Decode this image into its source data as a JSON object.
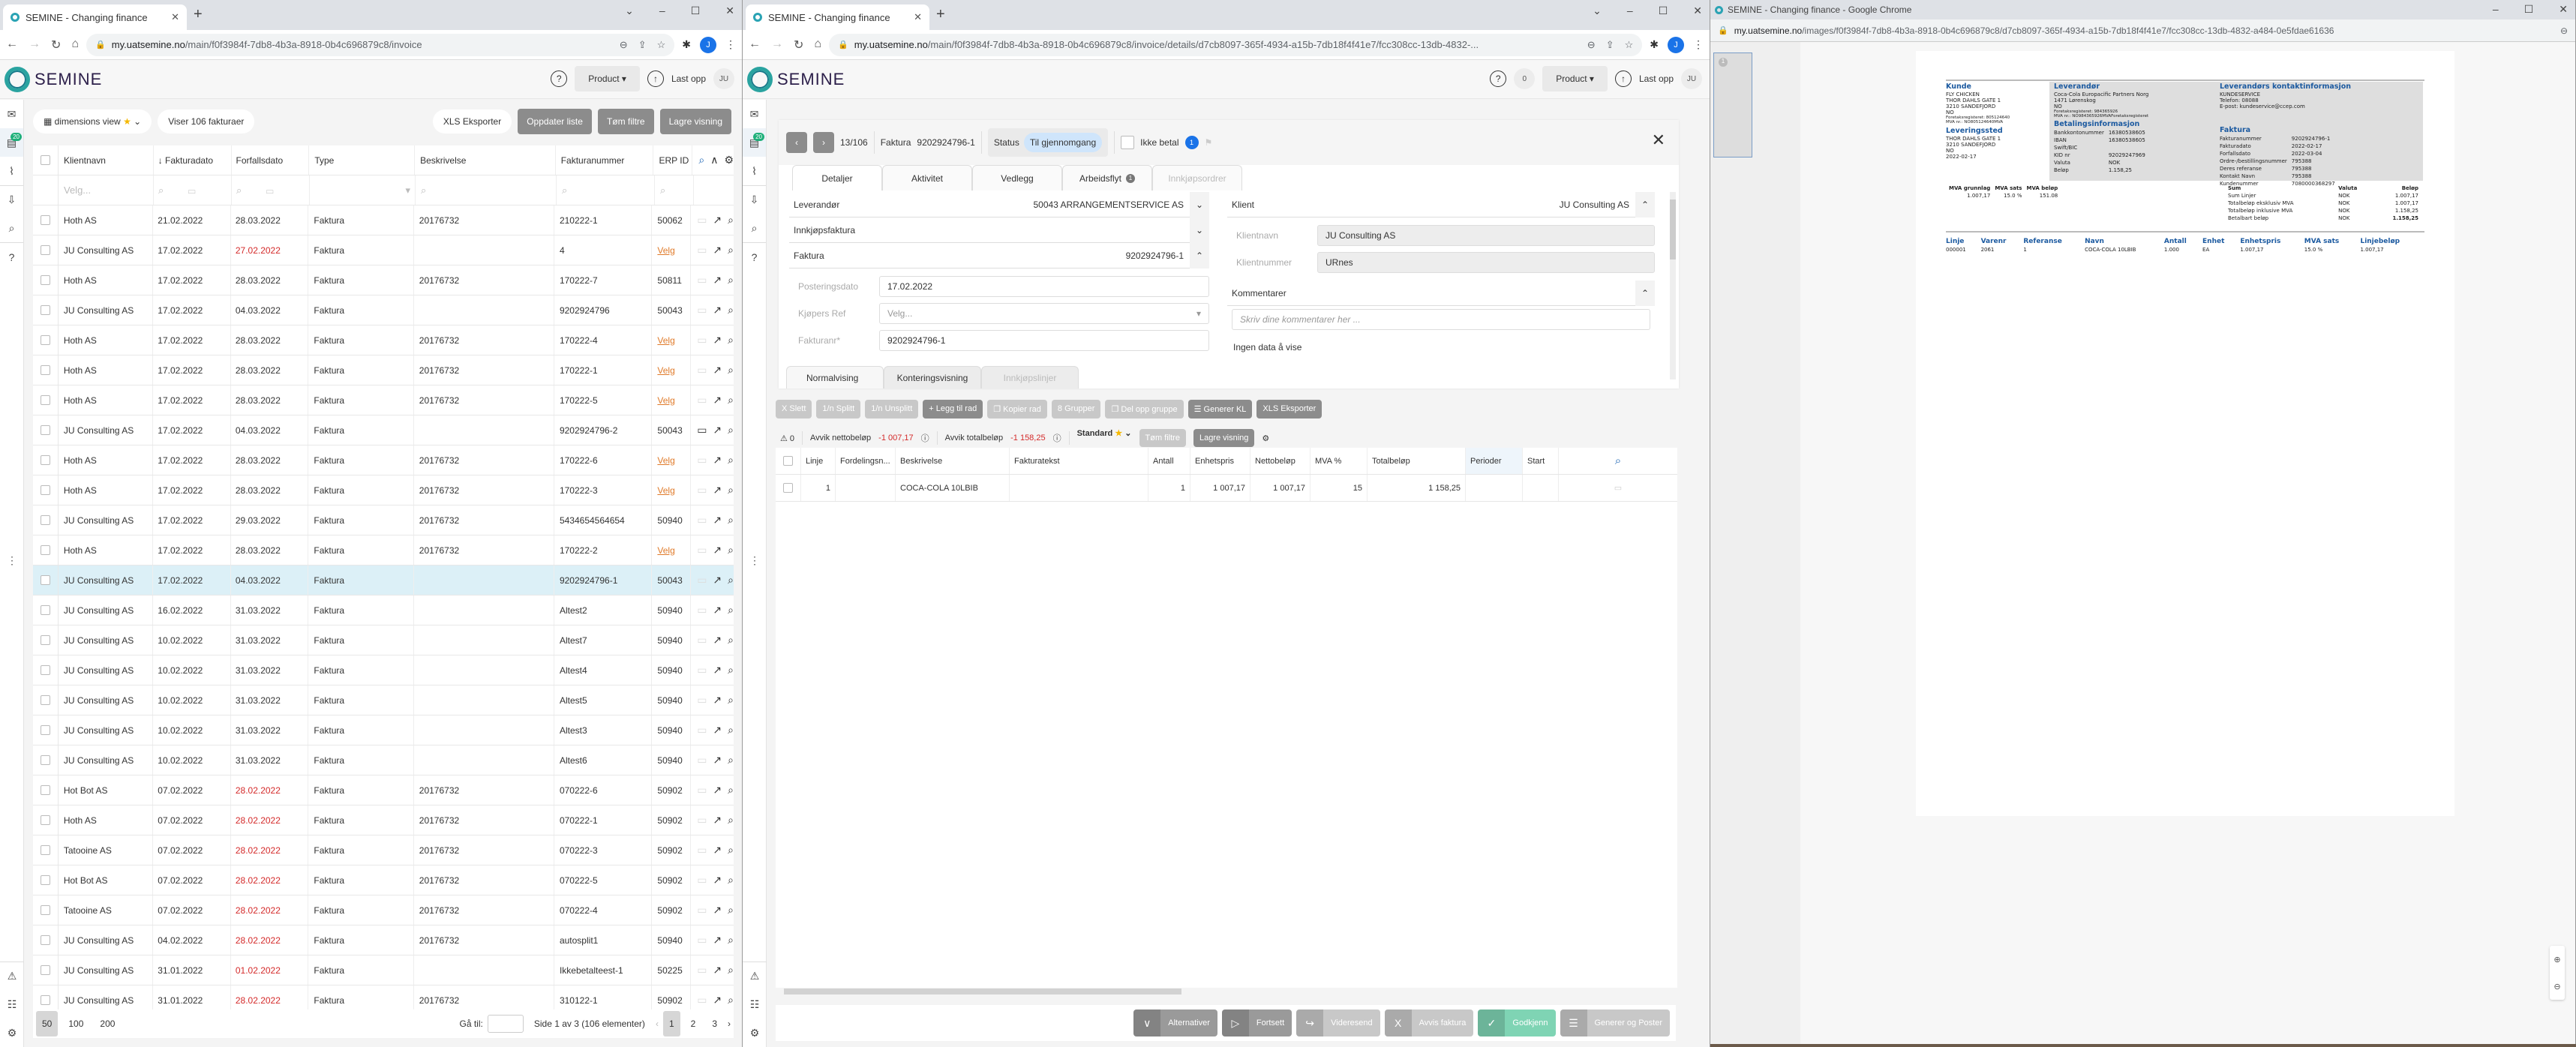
{
  "browser": {
    "tab_title": "SEMINE - Changing finance",
    "profile_initial": "J"
  },
  "window1": {
    "url_host": "my.uatsemine.no",
    "url_path": "/main/f0f3984f-7db8-4b3a-8918-0b4c696879c8/invoice",
    "app": {
      "logo": "SEMINE",
      "help": "?",
      "product_label": "Product",
      "upload_label": "Last opp",
      "user_initials": "JU"
    },
    "rail_badge": "20",
    "toolbar": {
      "view_label": "dimensions view",
      "count_label": "Viser 106 fakturaer",
      "export_label": "XLS Eksporter",
      "refresh_label": "Oppdater liste",
      "clear_filters_label": "Tøm filtre",
      "save_view_label": "Lagre visning"
    },
    "columns": [
      "Klientnavn",
      "Fakturadato",
      "Forfallsdato",
      "Type",
      "Beskrivelse",
      "Fakturanummer",
      "ERP ID"
    ],
    "filter_placeholder": "Velg...",
    "rows": [
      {
        "client": "Hoth AS",
        "inv_date": "21.02.2022",
        "due": "28.03.2022",
        "due_overdue": false,
        "type": "Faktura",
        "desc": "20176732",
        "no": "210222-1",
        "erp": "50062",
        "comment": false,
        "selected": false
      },
      {
        "client": "JU Consulting AS",
        "inv_date": "17.02.2022",
        "due": "27.02.2022",
        "due_overdue": true,
        "type": "Faktura",
        "desc": "",
        "no": "4",
        "erp": "Velg",
        "comment": false,
        "selected": false
      },
      {
        "client": "Hoth AS",
        "inv_date": "17.02.2022",
        "due": "28.03.2022",
        "due_overdue": false,
        "type": "Faktura",
        "desc": "20176732",
        "no": "170222-7",
        "erp": "50811",
        "comment": false,
        "selected": false
      },
      {
        "client": "JU Consulting AS",
        "inv_date": "17.02.2022",
        "due": "04.03.2022",
        "due_overdue": false,
        "type": "Faktura",
        "desc": "",
        "no": "9202924796",
        "erp": "50043",
        "comment": false,
        "selected": false
      },
      {
        "client": "Hoth AS",
        "inv_date": "17.02.2022",
        "due": "28.03.2022",
        "due_overdue": false,
        "type": "Faktura",
        "desc": "20176732",
        "no": "170222-4",
        "erp": "Velg",
        "comment": false,
        "selected": false
      },
      {
        "client": "Hoth AS",
        "inv_date": "17.02.2022",
        "due": "28.03.2022",
        "due_overdue": false,
        "type": "Faktura",
        "desc": "20176732",
        "no": "170222-1",
        "erp": "Velg",
        "comment": false,
        "selected": false
      },
      {
        "client": "Hoth AS",
        "inv_date": "17.02.2022",
        "due": "28.03.2022",
        "due_overdue": false,
        "type": "Faktura",
        "desc": "20176732",
        "no": "170222-5",
        "erp": "Velg",
        "comment": false,
        "selected": false
      },
      {
        "client": "JU Consulting AS",
        "inv_date": "17.02.2022",
        "due": "04.03.2022",
        "due_overdue": false,
        "type": "Faktura",
        "desc": "",
        "no": "9202924796-2",
        "erp": "50043",
        "comment": true,
        "selected": false
      },
      {
        "client": "Hoth AS",
        "inv_date": "17.02.2022",
        "due": "28.03.2022",
        "due_overdue": false,
        "type": "Faktura",
        "desc": "20176732",
        "no": "170222-6",
        "erp": "Velg",
        "comment": false,
        "selected": false
      },
      {
        "client": "Hoth AS",
        "inv_date": "17.02.2022",
        "due": "28.03.2022",
        "due_overdue": false,
        "type": "Faktura",
        "desc": "20176732",
        "no": "170222-3",
        "erp": "Velg",
        "comment": false,
        "selected": false
      },
      {
        "client": "JU Consulting AS",
        "inv_date": "17.02.2022",
        "due": "29.03.2022",
        "due_overdue": false,
        "type": "Faktura",
        "desc": "20176732",
        "no": "5434654564654",
        "erp": "50940",
        "comment": false,
        "selected": false
      },
      {
        "client": "Hoth AS",
        "inv_date": "17.02.2022",
        "due": "28.03.2022",
        "due_overdue": false,
        "type": "Faktura",
        "desc": "20176732",
        "no": "170222-2",
        "erp": "Velg",
        "comment": false,
        "selected": false
      },
      {
        "client": "JU Consulting AS",
        "inv_date": "17.02.2022",
        "due": "04.03.2022",
        "due_overdue": false,
        "type": "Faktura",
        "desc": "",
        "no": "9202924796-1",
        "erp": "50043",
        "comment": false,
        "selected": true
      },
      {
        "client": "JU Consulting AS",
        "inv_date": "16.02.2022",
        "due": "31.03.2022",
        "due_overdue": false,
        "type": "Faktura",
        "desc": "",
        "no": "Altest2",
        "erp": "50940",
        "comment": false,
        "selected": false
      },
      {
        "client": "JU Consulting AS",
        "inv_date": "10.02.2022",
        "due": "31.03.2022",
        "due_overdue": false,
        "type": "Faktura",
        "desc": "",
        "no": "Altest7",
        "erp": "50940",
        "comment": false,
        "selected": false
      },
      {
        "client": "JU Consulting AS",
        "inv_date": "10.02.2022",
        "due": "31.03.2022",
        "due_overdue": false,
        "type": "Faktura",
        "desc": "",
        "no": "Altest4",
        "erp": "50940",
        "comment": false,
        "selected": false
      },
      {
        "client": "JU Consulting AS",
        "inv_date": "10.02.2022",
        "due": "31.03.2022",
        "due_overdue": false,
        "type": "Faktura",
        "desc": "",
        "no": "Altest5",
        "erp": "50940",
        "comment": false,
        "selected": false
      },
      {
        "client": "JU Consulting AS",
        "inv_date": "10.02.2022",
        "due": "31.03.2022",
        "due_overdue": false,
        "type": "Faktura",
        "desc": "",
        "no": "Altest3",
        "erp": "50940",
        "comment": false,
        "selected": false
      },
      {
        "client": "JU Consulting AS",
        "inv_date": "10.02.2022",
        "due": "31.03.2022",
        "due_overdue": false,
        "type": "Faktura",
        "desc": "",
        "no": "Altest6",
        "erp": "50940",
        "comment": false,
        "selected": false
      },
      {
        "client": "Hot Bot AS",
        "inv_date": "07.02.2022",
        "due": "28.02.2022",
        "due_overdue": true,
        "type": "Faktura",
        "desc": "20176732",
        "no": "070222-6",
        "erp": "50902",
        "comment": false,
        "selected": false
      },
      {
        "client": "Hoth AS",
        "inv_date": "07.02.2022",
        "due": "28.02.2022",
        "due_overdue": true,
        "type": "Faktura",
        "desc": "20176732",
        "no": "070222-1",
        "erp": "50902",
        "comment": false,
        "selected": false
      },
      {
        "client": "Tatooine AS",
        "inv_date": "07.02.2022",
        "due": "28.02.2022",
        "due_overdue": true,
        "type": "Faktura",
        "desc": "20176732",
        "no": "070222-3",
        "erp": "50902",
        "comment": false,
        "selected": false
      },
      {
        "client": "Hot Bot AS",
        "inv_date": "07.02.2022",
        "due": "28.02.2022",
        "due_overdue": true,
        "type": "Faktura",
        "desc": "20176732",
        "no": "070222-5",
        "erp": "50902",
        "comment": false,
        "selected": false
      },
      {
        "client": "Tatooine AS",
        "inv_date": "07.02.2022",
        "due": "28.02.2022",
        "due_overdue": true,
        "type": "Faktura",
        "desc": "20176732",
        "no": "070222-4",
        "erp": "50902",
        "comment": false,
        "selected": false
      },
      {
        "client": "JU Consulting AS",
        "inv_date": "04.02.2022",
        "due": "28.02.2022",
        "due_overdue": true,
        "type": "Faktura",
        "desc": "20176732",
        "no": "autosplit1",
        "erp": "50940",
        "comment": false,
        "selected": false
      },
      {
        "client": "JU Consulting AS",
        "inv_date": "31.01.2022",
        "due": "01.02.2022",
        "due_overdue": true,
        "type": "Faktura",
        "desc": "",
        "no": "Ikkebetalteest-1",
        "erp": "50225",
        "comment": false,
        "selected": false
      },
      {
        "client": "JU Consulting AS",
        "inv_date": "31.01.2022",
        "due": "28.02.2022",
        "due_overdue": true,
        "type": "Faktura",
        "desc": "20176732",
        "no": "310122-1",
        "erp": "50902",
        "comment": false,
        "selected": false
      }
    ],
    "pager": {
      "sizes": [
        "50",
        "100",
        "200"
      ],
      "active_size": "50",
      "goto_label": "Gå til:",
      "summary": "Side 1 av 3 (106 elementer)",
      "pages": [
        "1",
        "2",
        "3"
      ],
      "current_page": "1"
    }
  },
  "window2": {
    "url_host": "my.uatsemine.no",
    "url_path": "/main/f0f3984f-7db8-4b3a-8918-0b4c696879c8/invoice/details/d7cb8097-365f-4934-a15b-7db18f4f41e7/fcc308cc-13db-4832-...",
    "app": {
      "logo": "SEMINE",
      "notif_count": "0",
      "product_label": "Product",
      "upload_label": "Last opp",
      "user_initials": "JU"
    },
    "detail": {
      "position": "13/106",
      "invoice_label": "Faktura",
      "invoice_no": "9202924796-1",
      "status_label": "Status",
      "status_value": "Til gjennomgang",
      "dont_pay_label": "Ikke betal",
      "workflow_count": "1",
      "tabs": [
        {
          "label": "Detaljer",
          "active": true,
          "disabled": false
        },
        {
          "label": "Aktivitet",
          "active": false,
          "disabled": false
        },
        {
          "label": "Vedlegg",
          "active": false,
          "disabled": false
        },
        {
          "label": "Arbeidsflyt",
          "active": false,
          "disabled": false,
          "badge": "1"
        },
        {
          "label": "Innkjøpsordrer",
          "active": false,
          "disabled": true
        }
      ],
      "supplier_label": "Leverandør",
      "supplier_value": "50043 ARRANGEMENTSERVICE AS",
      "purchase_invoice_label": "Innkjøpsfaktura",
      "invoice_section_label": "Faktura",
      "invoice_section_value": "9202924796-1",
      "fields": [
        {
          "label": "Posteringsdato",
          "value": "17.02.2022",
          "placeholder": false
        },
        {
          "label": "Kjøpers Ref",
          "value": "Velg...",
          "placeholder": true
        },
        {
          "label": "Fakturanr*",
          "value": "9202924796-1",
          "placeholder": false
        }
      ],
      "client_label": "Klient",
      "client_value": "JU Consulting AS",
      "client_fields": [
        {
          "label": "Klientnavn",
          "value": "JU Consulting AS"
        },
        {
          "label": "Klientnummer",
          "value": "URnes"
        }
      ],
      "comments_label": "Kommentarer",
      "comments_placeholder": "Skriv dine kommentarer her ...",
      "no_data": "Ingen data å vise"
    },
    "subtabs": [
      {
        "label": "Normalvising",
        "active": true,
        "disabled": false
      },
      {
        "label": "Konteringsvisning",
        "active": false,
        "disabled": false
      },
      {
        "label": "Innkjøpslinjer",
        "active": false,
        "disabled": true
      }
    ],
    "line_actions": [
      {
        "icon": "X",
        "label": "Slett",
        "dark": false
      },
      {
        "icon": "1/n",
        "label": "Splitt",
        "dark": false
      },
      {
        "icon": "1/n",
        "label": "Unsplitt",
        "dark": false
      },
      {
        "icon": "+",
        "label": "Legg til rad",
        "dark": true
      },
      {
        "icon": "❐",
        "label": "Kopier rad",
        "dark": false
      },
      {
        "icon": "8",
        "label": "Grupper",
        "dark": false
      },
      {
        "icon": "❐",
        "label": "Del opp gruppe",
        "dark": false
      },
      {
        "icon": "☰",
        "label": "Generer KL",
        "dark": true
      },
      {
        "icon": "XLS",
        "label": "Eksporter",
        "dark": true
      }
    ],
    "summary": {
      "warnings": "0",
      "net_dev_label": "Avvik nettobeløp",
      "net_dev_value": "-1 007,17",
      "total_dev_label": "Avvik totalbeløp",
      "total_dev_value": "-1 158,25",
      "view_label": "Standard",
      "clear_filters_label": "Tøm filtre",
      "save_view_label": "Lagre visning"
    },
    "line_columns": [
      "Linje",
      "Fordelingsn...",
      "Beskrivelse",
      "Fakturatekst",
      "Antall",
      "Enhetspris",
      "Nettobeløp",
      "MVA %",
      "Totalbeløp",
      "Perioder",
      "Start"
    ],
    "lines": [
      {
        "linje": "1",
        "fordeling": "",
        "beskrivelse": "COCA-COLA 10LBIB",
        "fakturatekst": "",
        "antall": "1",
        "enhetspris": "1 007,17",
        "netto": "1 007,17",
        "mva": "15",
        "total": "1 158,25",
        "perioder": "",
        "start": ""
      }
    ],
    "footer_actions": [
      {
        "icon": "∨",
        "label": "Alternativer",
        "style": "dk"
      },
      {
        "icon": "▷",
        "label": "Fortsett",
        "style": "dk"
      },
      {
        "icon": "↪",
        "label": "Videresend",
        "style": "lt"
      },
      {
        "icon": "X",
        "label": "Avvis faktura",
        "style": "lt"
      },
      {
        "icon": "✓",
        "label": "Godkjenn",
        "style": "gr"
      },
      {
        "icon": "☰",
        "label": "Generer og Poster",
        "style": "lt"
      }
    ]
  },
  "window3": {
    "title": "SEMINE - Changing finance - Google Chrome",
    "url_host": "my.uatsemine.no",
    "url_path": "/images/f0f3984f-7db8-4b3a-8918-0b4c696879c8/d7cb8097-365f-4934-a15b-7db18f4f41e7/fcc308cc-13db-4832-a484-0e5fdae61636",
    "thumb_page": "1",
    "invoice": {
      "kunde_h": "Kunde",
      "kunde": [
        "FLY CHICKEN",
        "THOR DAHLS GATE 1",
        "3210  SANDEFJORD",
        "NO"
      ],
      "kunde_small": [
        "Foretaksregisteret:  805124640",
        "MVA nr.:  NO805124640MVA"
      ],
      "levsted_h": "Leveringssted",
      "levsted": [
        "THOR DAHLS GATE 1",
        "3210  SANDEFJORD",
        "NO",
        "2022-02-17"
      ],
      "lev_h": "Leverandør",
      "lev": [
        "Coca-Cola Europacific Partners Norg",
        "1471  Lørenskog",
        "NO"
      ],
      "lev_small": [
        "Foretaksregisteret:  984365926",
        "MVA nr.:  NO984365926MVAForetaksregisteret"
      ],
      "kontakt_h": "Leverandørs kontaktinformasjon",
      "kontakt": [
        "KUNDESERVICE",
        "Telefon:  08088",
        "E-post:  kundeservice@ccep.com"
      ],
      "bet_h": "Betalingsinformasjon",
      "bet": [
        [
          "Bankkontonummer",
          "16380538605"
        ],
        [
          "IBAN",
          "16380538605"
        ],
        [
          "Swift/BIC",
          ""
        ],
        [
          "KID nr",
          "92029247969"
        ],
        [
          "Valuta",
          "NOK"
        ],
        [
          "Beløp",
          "1.158,25"
        ]
      ],
      "fakt_h": "Faktura",
      "fakt": [
        [
          "Fakturanummer",
          "9202924796-1"
        ],
        [
          "Fakturadato",
          "2022-02-17"
        ],
        [
          "Forfallsdato",
          "2022-03-04"
        ],
        [
          "Ordre-/bestillingsnummer",
          "795388"
        ],
        [
          "Deres referanse",
          "795388"
        ],
        [
          "Kontakt Navn",
          "795388"
        ],
        [
          "Kundenummer",
          "7080000368297"
        ]
      ],
      "vat_head": [
        "MVA grunnlag",
        "MVA sats",
        "MVA beløp"
      ],
      "vat_row": [
        "1.007,17",
        "15.0 %",
        "151.08"
      ],
      "sum_head": [
        "Sum",
        "Valuta",
        "Beløp"
      ],
      "sum_rows": [
        [
          "Sum Linjer",
          "NOK",
          "1.007,17"
        ],
        [
          "Totalbeløp eksklusiv MVA",
          "NOK",
          "1.007,17"
        ],
        [
          "Totalbeløp inklusive MVA",
          "NOK",
          "1.158,25"
        ],
        [
          "Betalbart beløp",
          "NOK",
          "1.158,25"
        ]
      ],
      "line_head": [
        "Linje",
        "Varenr",
        "Referanse",
        "Navn",
        "Antall",
        "Enhet",
        "Enhetspris",
        "MVA sats",
        "Linjebeløp"
      ],
      "line_row": [
        "000001",
        "2061",
        "1",
        "COCA-COLA 10LBIB",
        "1.000",
        "EA",
        "1.007,17",
        "15.0 %",
        "1.007,17"
      ]
    }
  }
}
